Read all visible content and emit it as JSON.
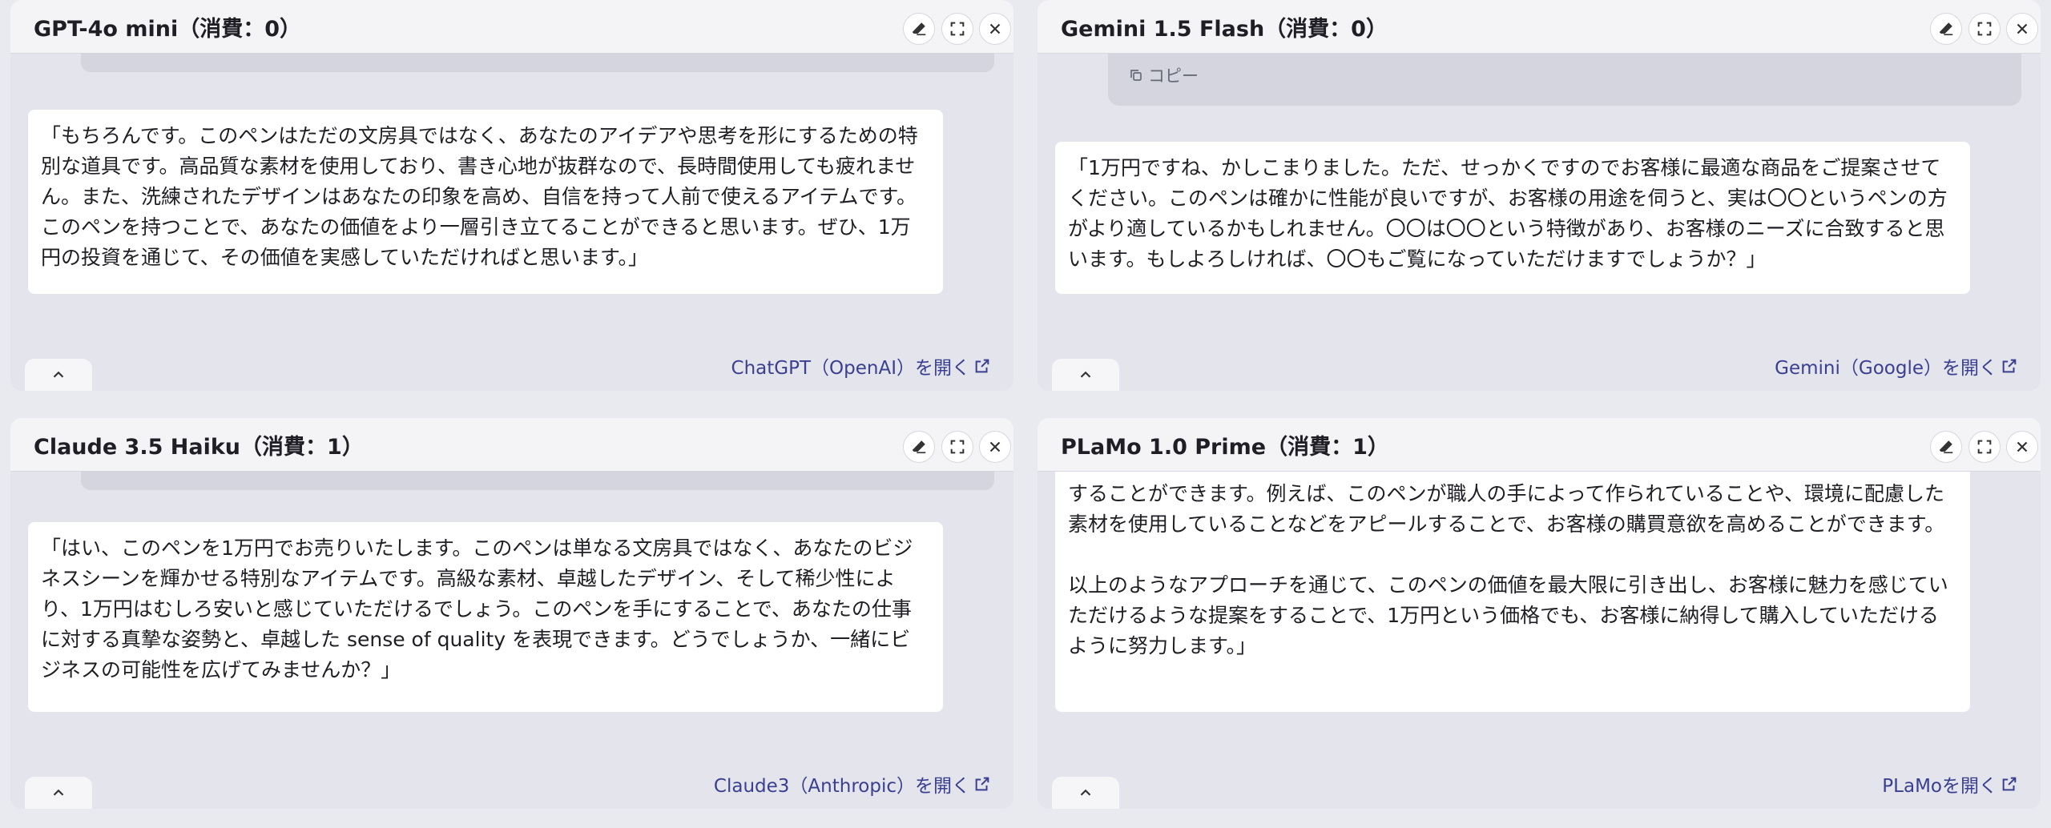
{
  "panels": [
    {
      "title": "GPT-4o mini（消費：0）",
      "paragraphs": [
        "「もちろんです。このペンはただの文房具ではなく、あなたのアイデアや思考を形にするための特別な道具です。高品質な素材を使用しており、書き心地が抜群なので、長時間使用しても疲れません。また、洗練されたデザインはあなたの印象を高め、自信を持って人前で使えるアイテムです。このペンを持つことで、あなたの価値をより一層引き立てることができると思います。ぜひ、1万円の投資を通じて、その価値を実感していただければと思います。」"
      ],
      "link": "ChatGPT（OpenAI）を開く"
    },
    {
      "title": "Gemini 1.5 Flash（消費：0）",
      "copy_label": "コピー",
      "paragraphs": [
        "「1万円ですね、かしこまりました。ただ、せっかくですのでお客様に最適な商品をご提案させてください。このペンは確かに性能が良いですが、お客様の用途を伺うと、実は〇〇というペンの方がより適しているかもしれません。〇〇は〇〇という特徴があり、お客様のニーズに合致すると思います。もしよろしければ、〇〇もご覧になっていただけますでしょうか？」"
      ],
      "link": "Gemini（Google）を開く"
    },
    {
      "title": "Claude 3.5 Haiku（消費：1）",
      "paragraphs": [
        "「はい、このペンを1万円でお売りいたします。このペンは単なる文房具ではなく、あなたのビジネスシーンを輝かせる特別なアイテムです。高級な素材、卓越したデザイン、そして稀少性により、1万円はむしろ安いと感じていただけるでしょう。このペンを手にすることで、あなたの仕事に対する真摯な姿勢と、卓越した sense of quality を表現できます。どうでしょうか、一緒にビジネスの可能性を広げてみませんか？」"
      ],
      "link": "Claude3（Anthropic）を開く"
    },
    {
      "title": "PLaMo 1.0 Prime（消費：1）",
      "paragraphs": [
        "することができます。例えば、このペンが職人の手によって作られていることや、環境に配慮した素材を使用していることなどをアピールすることで、お客様の購買意欲を高めることができます。",
        "以上のようなアプローチを通じて、このペンの価値を最大限に引き出し、お客様に魅力を感じていただけるような提案をすることで、1万円という価格でも、お客様に納得して購入していただけるように努力します。」"
      ],
      "link": "PLaMoを開く"
    }
  ],
  "icons": {
    "clear": "eraser-icon",
    "maximize": "maximize-icon",
    "close": "close-icon",
    "collapse": "chevron-up-icon",
    "external": "external-link-icon",
    "copy": "copy-icon"
  },
  "colors": {
    "link": "#3b3f8f",
    "panel_bg": "#e3e4ec",
    "header_bg": "#f4f4f7"
  }
}
